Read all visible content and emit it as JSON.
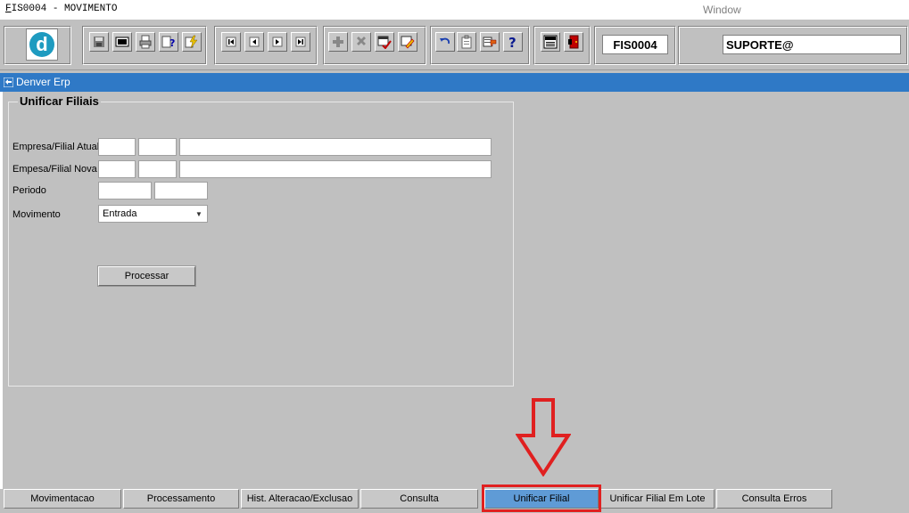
{
  "window": {
    "title_prefix": "F",
    "title_rest": "IS0004 - MOVIMENTO",
    "menu_window": "Window"
  },
  "toolbar": {
    "logo_letter": "d",
    "form_code": "FIS0004",
    "user": "SUPORTE@"
  },
  "app_bar": {
    "title": "Denver Erp"
  },
  "panel": {
    "title": "Unificar Filiais",
    "labels": {
      "empresa_atual": "Empresa/Filial Atual",
      "empresa_nova": "Empesa/Filial Nova",
      "periodo": "Periodo",
      "movimento": "Movimento"
    },
    "movimento_value": "Entrada",
    "process_button": "Processar"
  },
  "tabs": [
    {
      "label": "Movimentacao"
    },
    {
      "label": "Processamento"
    },
    {
      "label": "Hist. Alteracao/Exclusao"
    },
    {
      "label": "Consulta"
    },
    {
      "label": "Unificar Filial"
    },
    {
      "label": "Unificar Filial Em Lote"
    },
    {
      "label": "Consulta Erros"
    }
  ],
  "colors": {
    "accent_bar": "#2f79c6",
    "active_tab": "#5f9bd6",
    "annotation_red": "#e02020"
  }
}
